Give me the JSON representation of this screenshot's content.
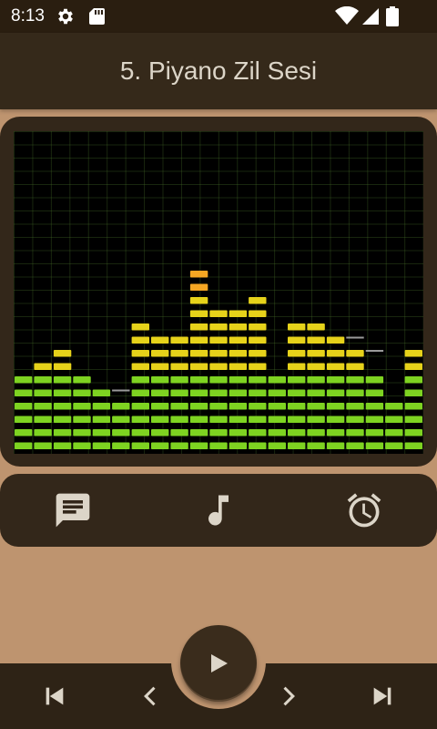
{
  "status_bar": {
    "time": "8:13",
    "icons": [
      "settings-gear-icon",
      "sd-card-icon",
      "wifi-icon",
      "cell-signal-icon",
      "battery-icon"
    ]
  },
  "app_bar": {
    "title": "5. Piyano Zil Sesi"
  },
  "visualizer": {
    "levels": [
      6,
      7,
      8,
      6,
      5,
      4,
      10,
      9,
      9,
      14,
      11,
      11,
      12,
      6,
      10,
      10,
      9,
      8,
      6,
      4,
      8
    ],
    "peaks": [
      6,
      5,
      8,
      6,
      5,
      5,
      10,
      9,
      9,
      14,
      11,
      11,
      12,
      6,
      10,
      10,
      9,
      9,
      8,
      4,
      8
    ],
    "max_level": 22,
    "colors": {
      "low": "#7ED321",
      "mid": "#E6D21A",
      "high": "#F5A623",
      "grid": "#3D5A22"
    }
  },
  "actions": [
    {
      "icon": "message-icon"
    },
    {
      "icon": "music-note-icon"
    },
    {
      "icon": "alarm-icon"
    }
  ],
  "player_controls": {
    "icons": [
      "skip-previous-icon",
      "chevron-left-icon",
      "play-icon",
      "chevron-right-icon",
      "skip-next-icon"
    ]
  },
  "colors": {
    "background": "#BE946F",
    "card": "#33271A",
    "app_bar": "#35291A",
    "icon": "#DCD5C8"
  }
}
